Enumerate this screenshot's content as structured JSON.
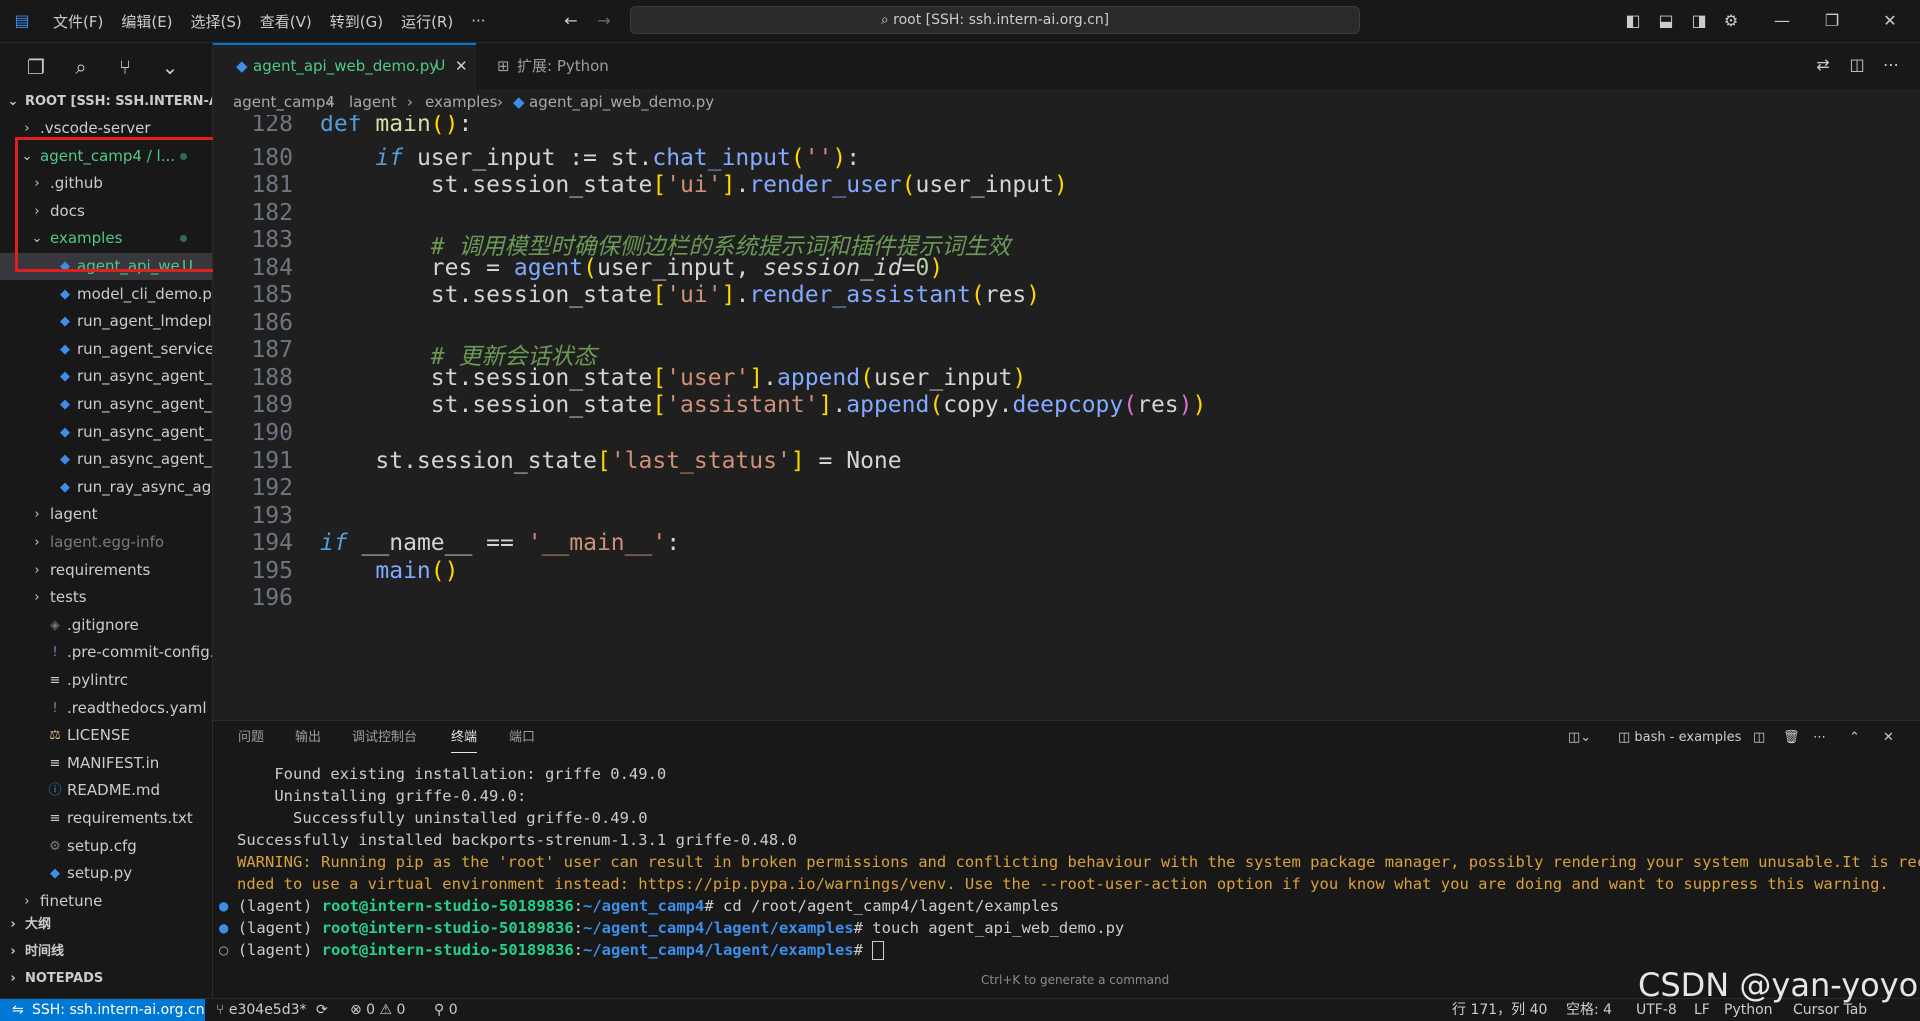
{
  "titlebar": {
    "menus": [
      "文件(F)",
      "编辑(E)",
      "选择(S)",
      "查看(V)",
      "转到(G)",
      "运行(R)",
      "···"
    ],
    "search": "root [SSH: ssh.intern-ai.org.cn]"
  },
  "explorer": {
    "root_label": "ROOT [SSH: SSH.INTERN-A...",
    "items": [
      {
        "label": ".vscode-server",
        "type": "folder",
        "collapsed": true
      },
      {
        "label": "agent_camp4 / l...",
        "type": "folder",
        "collapsed": false
      },
      {
        "label": ".github",
        "type": "folder",
        "collapsed": true
      },
      {
        "label": "docs",
        "type": "folder",
        "collapsed": true
      },
      {
        "label": "examples",
        "type": "folder",
        "collapsed": false
      },
      {
        "label": "agent_api_we...",
        "type": "py",
        "badge": "U"
      },
      {
        "label": "model_cli_demo.py",
        "type": "py"
      },
      {
        "label": "run_agent_lmdeplo...",
        "type": "py"
      },
      {
        "label": "run_agent_services....",
        "type": "py"
      },
      {
        "label": "run_async_agent_l...",
        "type": "py"
      },
      {
        "label": "run_async_agent_l...",
        "type": "py"
      },
      {
        "label": "run_async_agent_o...",
        "type": "py"
      },
      {
        "label": "run_async_agent_vl...",
        "type": "py"
      },
      {
        "label": "run_ray_async_age...",
        "type": "py"
      },
      {
        "label": "lagent",
        "type": "folder",
        "collapsed": true
      },
      {
        "label": "lagent.egg-info",
        "type": "folder",
        "collapsed": true
      },
      {
        "label": "requirements",
        "type": "folder",
        "collapsed": true
      },
      {
        "label": "tests",
        "type": "folder",
        "collapsed": true
      },
      {
        "label": ".gitignore",
        "type": "git"
      },
      {
        "label": ".pre-commit-config....",
        "type": "yaml"
      },
      {
        "label": ".pylintrc",
        "type": "txt"
      },
      {
        "label": ".readthedocs.yaml",
        "type": "yaml"
      },
      {
        "label": "LICENSE",
        "type": "license"
      },
      {
        "label": "MANIFEST.in",
        "type": "txt"
      },
      {
        "label": "README.md",
        "type": "info"
      },
      {
        "label": "requirements.txt",
        "type": "txt"
      },
      {
        "label": "setup.cfg",
        "type": "gear"
      },
      {
        "label": "setup.py",
        "type": "py"
      },
      {
        "label": "finetune",
        "type": "folder",
        "collapsed": true
      }
    ],
    "sections": [
      "大纲",
      "时间线",
      "NOTEPADS"
    ]
  },
  "tabs": [
    {
      "label": "agent_api_web_demo.py",
      "badge": "U",
      "active": true
    },
    {
      "label": "扩展: Python",
      "active": false
    }
  ],
  "breadcrumb": [
    "agent_camp4",
    "lagent",
    "examples",
    "agent_api_web_demo.py"
  ],
  "editor": {
    "line_numbers": [
      "128",
      "180",
      "181",
      "182",
      "183",
      "184",
      "185",
      "186",
      "187",
      "188",
      "189",
      "190",
      "191",
      "192",
      "193",
      "194",
      "195",
      "196"
    ],
    "comment1": "# 调用模型时确保侧边栏的系统提示词和插件提示词生效",
    "comment2": "# 更新会话状态"
  },
  "panel": {
    "tabs": [
      "问题",
      "输出",
      "调试控制台",
      "终端",
      "端口"
    ],
    "active_tab": "终端",
    "terminal_name": "bash - examples",
    "lines": [
      "    Found existing installation: griffe 0.49.0",
      "    Uninstalling griffe-0.49.0:",
      "      Successfully uninstalled griffe-0.49.0",
      "Successfully installed backports-strenum-1.3.1 griffe-0.48.0"
    ],
    "warning1": "WARNING: Running pip as the 'root' user can result in broken permissions and conflicting behaviour with the system package manager, possibly rendering your system unusable.It is recomme",
    "warning2": "nded to use a virtual environment instead: https://pip.pypa.io/warnings/venv. Use the --root-user-action option if you know what you are doing and want to suppress this warning.",
    "prompts": [
      {
        "env": "(lagent) ",
        "user": "root@intern-studio-50189836",
        "path": "~/agent_camp4",
        "cmd": "# cd /root/agent_camp4/lagent/examples"
      },
      {
        "env": "(lagent) ",
        "user": "root@intern-studio-50189836",
        "path": "~/agent_camp4/lagent/examples",
        "cmd": "# touch agent_api_web_demo.py"
      },
      {
        "env": "(lagent) ",
        "user": "root@intern-studio-50189836",
        "path": "~/agent_camp4/lagent/examples",
        "cmd": "# "
      }
    ],
    "hint": "Ctrl+K to generate a command"
  },
  "statusbar": {
    "remote": "SSH: ssh.intern-ai.org.cn",
    "branch": "e304e5d3*",
    "problems": "⊗ 0 ⚠ 0",
    "ports": "0",
    "position": "行 171，列 40",
    "spaces": "空格: 4",
    "encoding": "UTF-8",
    "eol": "LF",
    "language": "Python",
    "cursor_tab": "Cursor Tab"
  },
  "watermark": "CSDN @yan-yoyo"
}
